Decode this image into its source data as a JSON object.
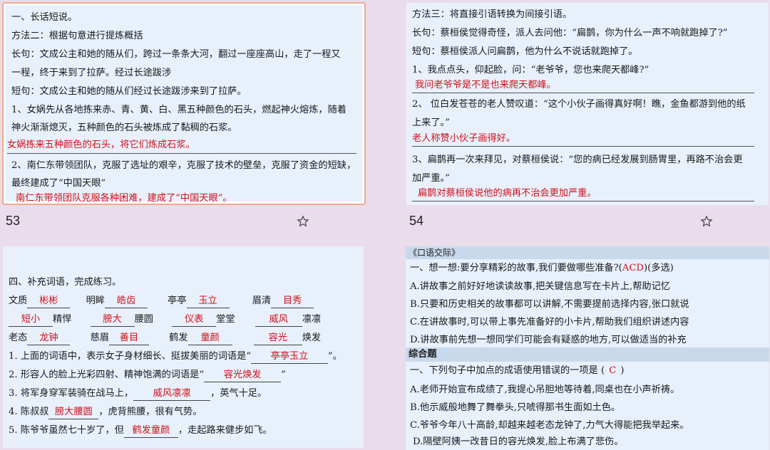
{
  "s53": {
    "l1": "一、长话短说。",
    "l2": "方法二：根据句意进行提炼概括",
    "l3": "长句：文成公主和她的随从们，跨过一条条大河，翻过一座座高山，走了一程又",
    "l4": "一程，终于来到了拉萨。经过长途跋涉",
    "l5": "短句：文成公主和她的随从们经过长途跋涉来到了拉萨。",
    "l6": "1、女娲先从各地拣来赤、青、黄、白、黑五种颜色的石头，燃起神火熔炼，随着",
    "l7": "神火渐渐熄灭，五种颜色的石头被炼成了黏稠的石浆。",
    "a1": "女娲拣来五种颜色的石头，将它们炼成石浆。",
    "l8": "2、南仁东带领团队，克服了选址的艰辛，克服了技术的壁垒，克服了资金的短缺，",
    "l9": "最终建成了“中国天眼”",
    "a2": "南仁东带领团队克服各种困难，建成了“中国天眼”。",
    "page": "53"
  },
  "s54": {
    "l1": "方法三：将直接引语转换为间接引语。",
    "l2": "长句：蔡桓侯觉得奇怪，派人去问他：“扁鹊，你为什么一声不响就跑掉了?”",
    "l3": "短句：蔡桓侯派人问扁鹊，他为什么不说话就跑掉了。",
    "l4": "1、我点点头，仰起脸，问：“老爷爷，您也来爬天都峰?”",
    "a1": "我问老爷爷是不是也来爬天都峰。",
    "l5": "2、 位白发苍苍的老人赞叹道：“这个小伙子画得真好啊！瞧，金鱼都游到他的纸",
    "l6": "上来了。”",
    "a2": "老人称赞小伙子画得好。",
    "l7": "3、扁鹊再一次来拜见，对蔡桓侯说：“您的病已经发展到肠胃里，再路不治会更",
    "l8": "加严重。”",
    "a3": "扁鹊对蔡桓侯说他的病再不治会更加严重。",
    "page": "54"
  },
  "s55": {
    "title": "四、补充词语，完成练习。",
    "r1": {
      "w1": "文质",
      "a1": "彬彬",
      "w2": "明眸",
      "a2": "皓齿",
      "w3": "亭亭",
      "a3": "玉立",
      "w4": "眉清",
      "a4": "目秀"
    },
    "r2": {
      "a1": "短小",
      "w1": "精悍",
      "a2": "膀大",
      "w2": "腰圆",
      "a3": "仪表",
      "w3": "堂堂",
      "a4": "威风",
      "w4": "凛凛"
    },
    "r3": {
      "w1": "老态",
      "a1": "龙钟",
      "w2": "慈眉",
      "a2": "善目",
      "w3": "鹤发",
      "a3": "童颜",
      "a4": "容光",
      "w4": "焕发"
    },
    "q1": {
      "pre": "1. 上面的词语中，表示女子身材细长、挺拔美丽的词语是“",
      "ans": "亭亭玉立",
      "post": "”。"
    },
    "q2": {
      "pre": "2. 形容人的脸上光彩四射、精神饱满的词语是“",
      "ans": "容光焕发",
      "post": "”"
    },
    "q3": {
      "pre": "3. 将军身穿军装骑在战马上，",
      "ans": "威风凛凛",
      "post": "，英气十足。"
    },
    "q4": {
      "pre": "4. 陈叔叔",
      "ans": "膀大腰圆",
      "post": "，虎背熊腰，很有气势。"
    },
    "q5": {
      "pre": "5. 陈爷爷虽然七十岁了，但",
      "ans": "鹤发童颜",
      "post": "，走起路来健步如飞。"
    }
  },
  "s56": {
    "title": "《口语交际》",
    "q1": {
      "pre": "一、想一想:要分享精彩的故事,我们要做哪些准备?(",
      "ans": "ACD",
      "post": ")(多选)"
    },
    "A": "A.讲故事之前好好地读读故事,把关键信息写在卡片上,帮助记忆",
    "B": "B.只要和历史相关的故事都可以讲解,不需要提前选择内容,张口就说",
    "C": "C.在讲故事时,可以带上事先准备好的小卡片,帮助我们组织讲述内容",
    "D": "D.讲故事前先想一想同学们可能会有疑惑的地方,可以做适当的补充",
    "sec": "综合题",
    "q2": {
      "pre": "一、下列句子中加点的成语使用错误的一项是 (",
      "ans": "C",
      "post": ")"
    },
    "A2": "A.老师开始宣布成绩了,我提心吊胆地等待着,同桌也在小声祈祷。",
    "B2": "B.他示威般地舞了舞拳头,只唬得那书生面如土色。",
    "C2": "C.爷爷今年八十高龄,却越来越老态龙钟了,力气大得能把我举起来。",
    "D2": "D.隔壁阿姨一改昔日的容光焕发,脸上布满了悲伤。"
  },
  "colors": {
    "answer": "#d1111b",
    "slide_bg": "#e7f0fb",
    "page_bg": "#e9ddeb",
    "frame": "#f3a98a"
  }
}
